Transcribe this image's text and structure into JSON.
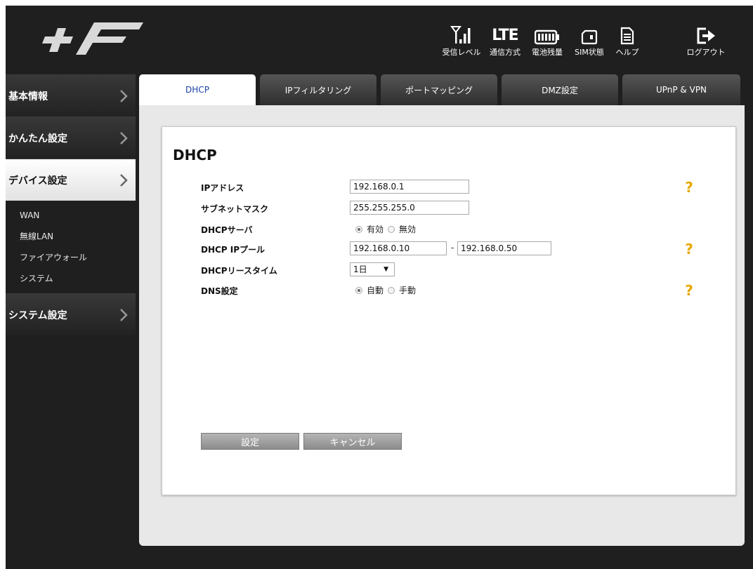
{
  "header": {
    "status": [
      {
        "icon": "signal-icon",
        "label": "受信レベル"
      },
      {
        "icon": "lte-icon",
        "label": "通信方式",
        "icon_text": "LTE"
      },
      {
        "icon": "battery-icon",
        "label": "電池残量"
      },
      {
        "icon": "sim-card-icon",
        "label": "SIM状態"
      },
      {
        "icon": "help-document-icon",
        "label": "ヘルプ"
      },
      {
        "icon": "logout-icon",
        "label": "ログアウト"
      }
    ]
  },
  "sidebar": {
    "items": [
      {
        "label": "基本情報"
      },
      {
        "label": "かんたん設定"
      },
      {
        "label": "デバイス設定",
        "active": true
      },
      {
        "label": "システム設定"
      }
    ],
    "submenu": [
      "WAN",
      "無線LAN",
      "ファイアウォール",
      "システム"
    ]
  },
  "tabs": [
    "DHCP",
    "IPフィルタリング",
    "ポートマッピング",
    "DMZ設定",
    "UPnP & VPN"
  ],
  "active_tab": "DHCP",
  "form": {
    "title": "DHCP",
    "ip_address_label": "IPアドレス",
    "ip_address_value": "192.168.0.1",
    "subnet_label": "サブネットマスク",
    "subnet_value": "255.255.255.0",
    "dhcp_server_label": "DHCPサーバ",
    "dhcp_server_options": [
      "有効",
      "無効"
    ],
    "dhcp_server_selected": "有効",
    "pool_label": "DHCP IPプール",
    "pool_start": "192.168.0.10",
    "pool_separator": "-",
    "pool_end": "192.168.0.50",
    "lease_label": "DHCPリースタイム",
    "lease_value": "1日",
    "dns_label": "DNS設定",
    "dns_options": [
      "自動",
      "手動"
    ],
    "dns_selected": "自動",
    "save_label": "設定",
    "cancel_label": "キャンセル"
  },
  "colors": {
    "active_tab_text": "#1a3fa8",
    "help_icon": "#e8a800",
    "dark_bg": "#1f1f1f"
  }
}
